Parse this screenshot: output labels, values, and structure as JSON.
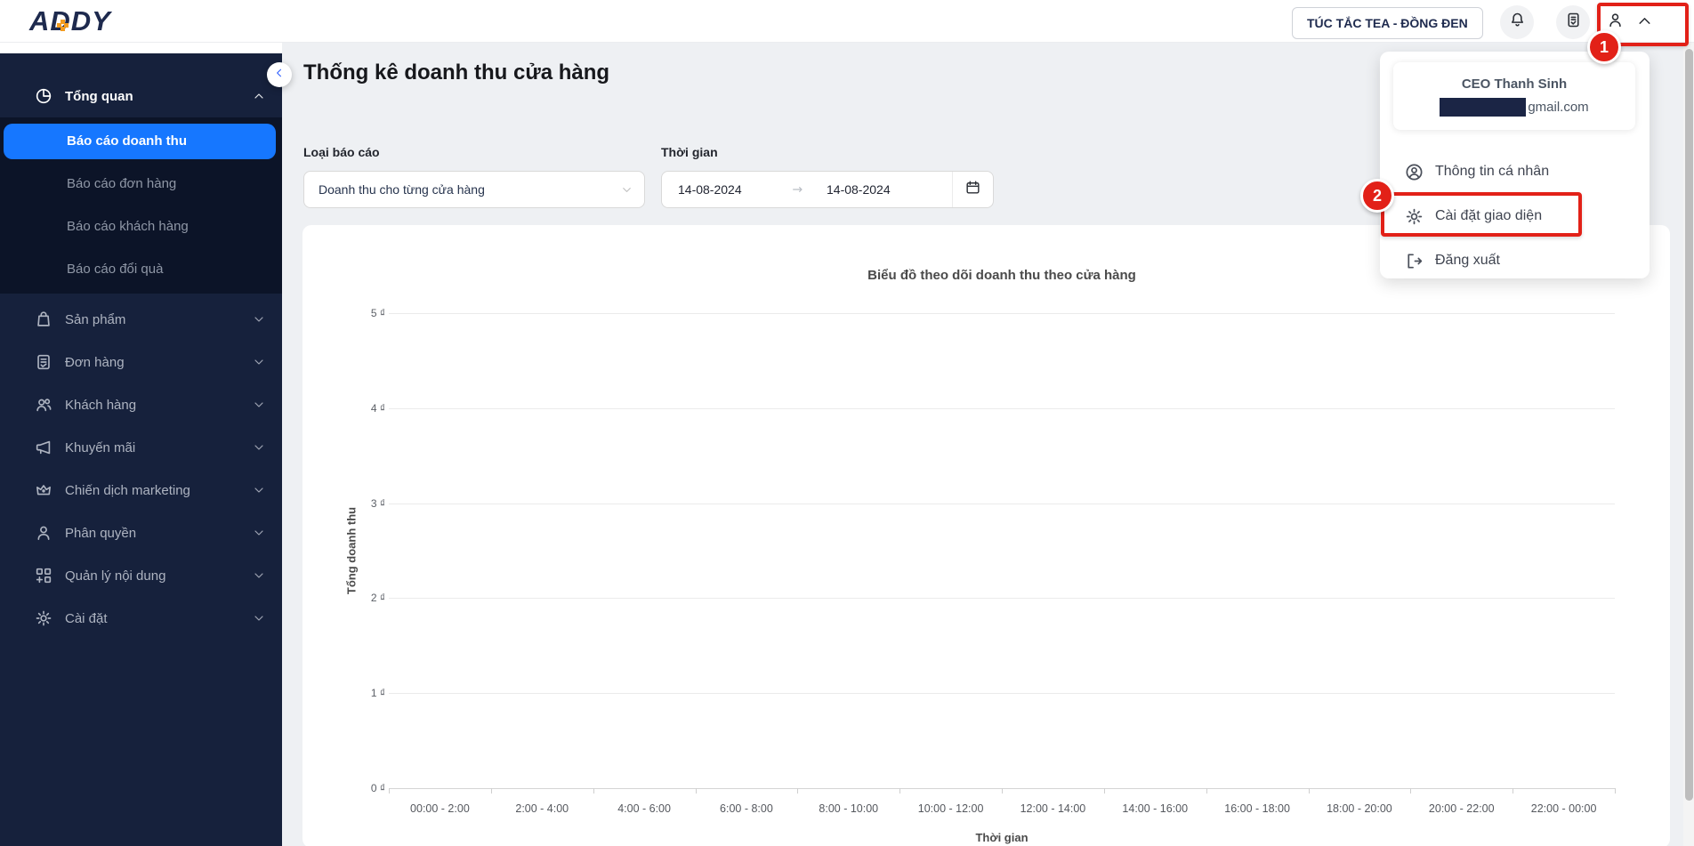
{
  "brand": {
    "logo_text": "ADDY",
    "logo_accent_color": "#F39C1F"
  },
  "header": {
    "store_button_label": "TÚC TẮC TEA - ĐỒNG ĐEN",
    "icons": [
      "bell-icon",
      "order-list-icon",
      "user-icon",
      "chevron-up-icon"
    ]
  },
  "sidebar": {
    "sections": [
      {
        "icon": "pie",
        "label": "Tổng quan",
        "expanded": true,
        "children": [
          {
            "label": "Báo cáo doanh thu",
            "active": true
          },
          {
            "label": "Báo cáo đơn hàng",
            "active": false
          },
          {
            "label": "Báo cáo khách hàng",
            "active": false
          },
          {
            "label": "Báo cáo đổi quà",
            "active": false
          }
        ]
      },
      {
        "icon": "bag",
        "label": "Sản phẩm",
        "expanded": false
      },
      {
        "icon": "receipt",
        "label": "Đơn hàng",
        "expanded": false
      },
      {
        "icon": "users",
        "label": "Khách hàng",
        "expanded": false
      },
      {
        "icon": "megaphone",
        "label": "Khuyến mãi",
        "expanded": false
      },
      {
        "icon": "crown",
        "label": "Chiến dịch marketing",
        "expanded": false
      },
      {
        "icon": "person",
        "label": "Phân quyền",
        "expanded": false
      },
      {
        "icon": "grid",
        "label": "Quản lý nội dung",
        "expanded": false
      },
      {
        "icon": "gear",
        "label": "Cài đặt",
        "expanded": false
      }
    ]
  },
  "page": {
    "title": "Thống kê doanh thu cửa hàng"
  },
  "filters": {
    "report_type_label": "Loại báo cáo",
    "report_type_value": "Doanh thu cho từng cửa hàng",
    "time_label": "Thời gian",
    "date_from": "14-08-2024",
    "date_to": "14-08-2024"
  },
  "user_menu": {
    "name": "CEO Thanh Sinh",
    "email_visible_part": "gmail.com",
    "email_redacted": true,
    "items": [
      {
        "icon": "user-circle",
        "label": "Thông tin cá nhân",
        "highlighted": false
      },
      {
        "icon": "gear",
        "label": "Cài đặt giao diện",
        "highlighted": true
      },
      {
        "icon": "logout",
        "label": "Đăng xuất",
        "highlighted": false
      }
    ]
  },
  "annotations": {
    "badge1": "1",
    "badge2": "2",
    "color": "#E22118"
  },
  "chart_data": {
    "type": "line",
    "title": "Biểu đồ theo dõi doanh thu theo cửa hàng",
    "xlabel": "Thời gian",
    "ylabel": "Tổng doanh thu",
    "categories": [
      "00:00 - 2:00",
      "2:00 - 4:00",
      "4:00 - 6:00",
      "6:00 - 8:00",
      "8:00 - 10:00",
      "10:00 - 12:00",
      "12:00 - 14:00",
      "14:00 - 16:00",
      "16:00 - 18:00",
      "18:00 - 20:00",
      "20:00 - 22:00",
      "22:00 - 00:00"
    ],
    "y_tick_labels": [
      "5 ₫",
      "4 ₫",
      "3 ₫",
      "2 ₫",
      "1 ₫",
      "0 ₫"
    ],
    "ylim": [
      0,
      5
    ],
    "currency": "₫",
    "grid": true,
    "legend": false,
    "series": []
  },
  "colors": {
    "sidebar_bg": "#16213C",
    "submenu_bg": "#0C1428",
    "active_item_blue": "#1677FF",
    "content_bg": "#EEF0F3",
    "annotation_red": "#E22118",
    "redaction_navy": "#1B2545"
  }
}
